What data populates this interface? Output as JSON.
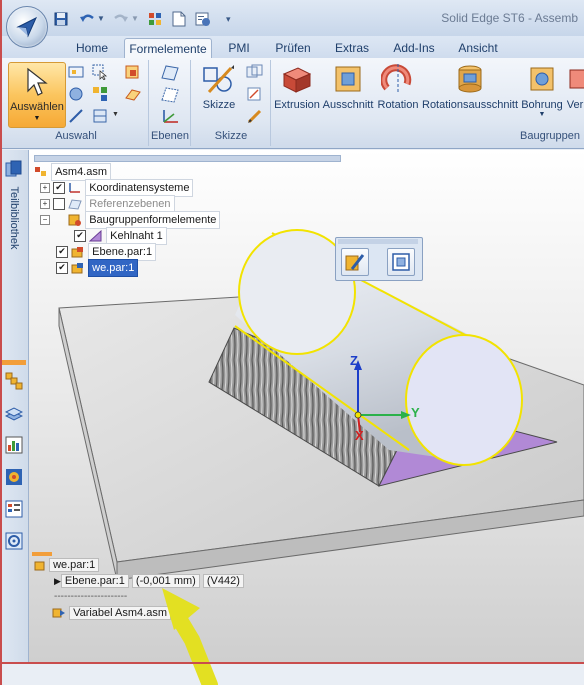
{
  "app": {
    "title": "Solid Edge ST6 - Assemb",
    "colors": {
      "accent": "#f6a935",
      "ribbon": "#dfe7f2",
      "selection": "#3166c4",
      "highlight": "#f2e300",
      "arrow": "#e3e022"
    }
  },
  "quick_access": [
    {
      "icon": "save-icon"
    },
    {
      "icon": "undo-icon"
    },
    {
      "icon": "redo-icon"
    },
    {
      "icon": "assembly-icon"
    },
    {
      "icon": "new-document-icon"
    },
    {
      "icon": "properties-icon"
    },
    {
      "icon": "customize-icon"
    }
  ],
  "tabs": [
    {
      "label": "Home",
      "active": false
    },
    {
      "label": "Formelemente",
      "active": true
    },
    {
      "label": "PMI",
      "active": false
    },
    {
      "label": "Prüfen",
      "active": false
    },
    {
      "label": "Extras",
      "active": false
    },
    {
      "label": "Add-Ins",
      "active": false
    },
    {
      "label": "Ansicht",
      "active": false
    }
  ],
  "ribbon": {
    "groups": {
      "auswahl": "Auswahl",
      "ebenen": "Ebenen",
      "skizze": "Skizze",
      "baugruppen": "Baugruppen"
    },
    "buttons": {
      "select": "Auswählen",
      "sketch": "Skizze",
      "extrusion": "Extrusion",
      "cutout": "Ausschnitt",
      "rotation": "Rotation",
      "rotation_cutout": "Rotationsausschnitt",
      "hole": "Bohrung",
      "more": "Ver"
    }
  },
  "side_panel": {
    "library_label": "Teilbibliothek",
    "icons": [
      "assembly-tree-icon",
      "layers-icon",
      "sensor-icon",
      "simulation-icon",
      "configurations-icon",
      "settings-icon"
    ]
  },
  "tree": {
    "root": "Asm4.asm",
    "items": [
      {
        "label": "Koordinatensysteme",
        "checked": true,
        "expander": "+"
      },
      {
        "label": "Referenzebenen",
        "checked": false,
        "expander": "+"
      },
      {
        "label": "Baugruppenformelemente",
        "checked": null,
        "expander": "−"
      },
      {
        "label": "Kehlnaht 1",
        "checked": true,
        "expander": ""
      },
      {
        "label": "Ebene.par:1",
        "checked": true,
        "expander": ""
      },
      {
        "label": "we.par:1",
        "checked": true,
        "expander": "",
        "selected": true
      }
    ]
  },
  "triad": {
    "z": "Z",
    "y": "Y",
    "x": "X"
  },
  "bottom_info": {
    "part": "we.par:1",
    "relation": "Ebene.par:1",
    "offset": "(-0,001 mm)",
    "id": "(V442)",
    "separator": "----------------------",
    "variable": "Variabel Asm4.asm"
  }
}
